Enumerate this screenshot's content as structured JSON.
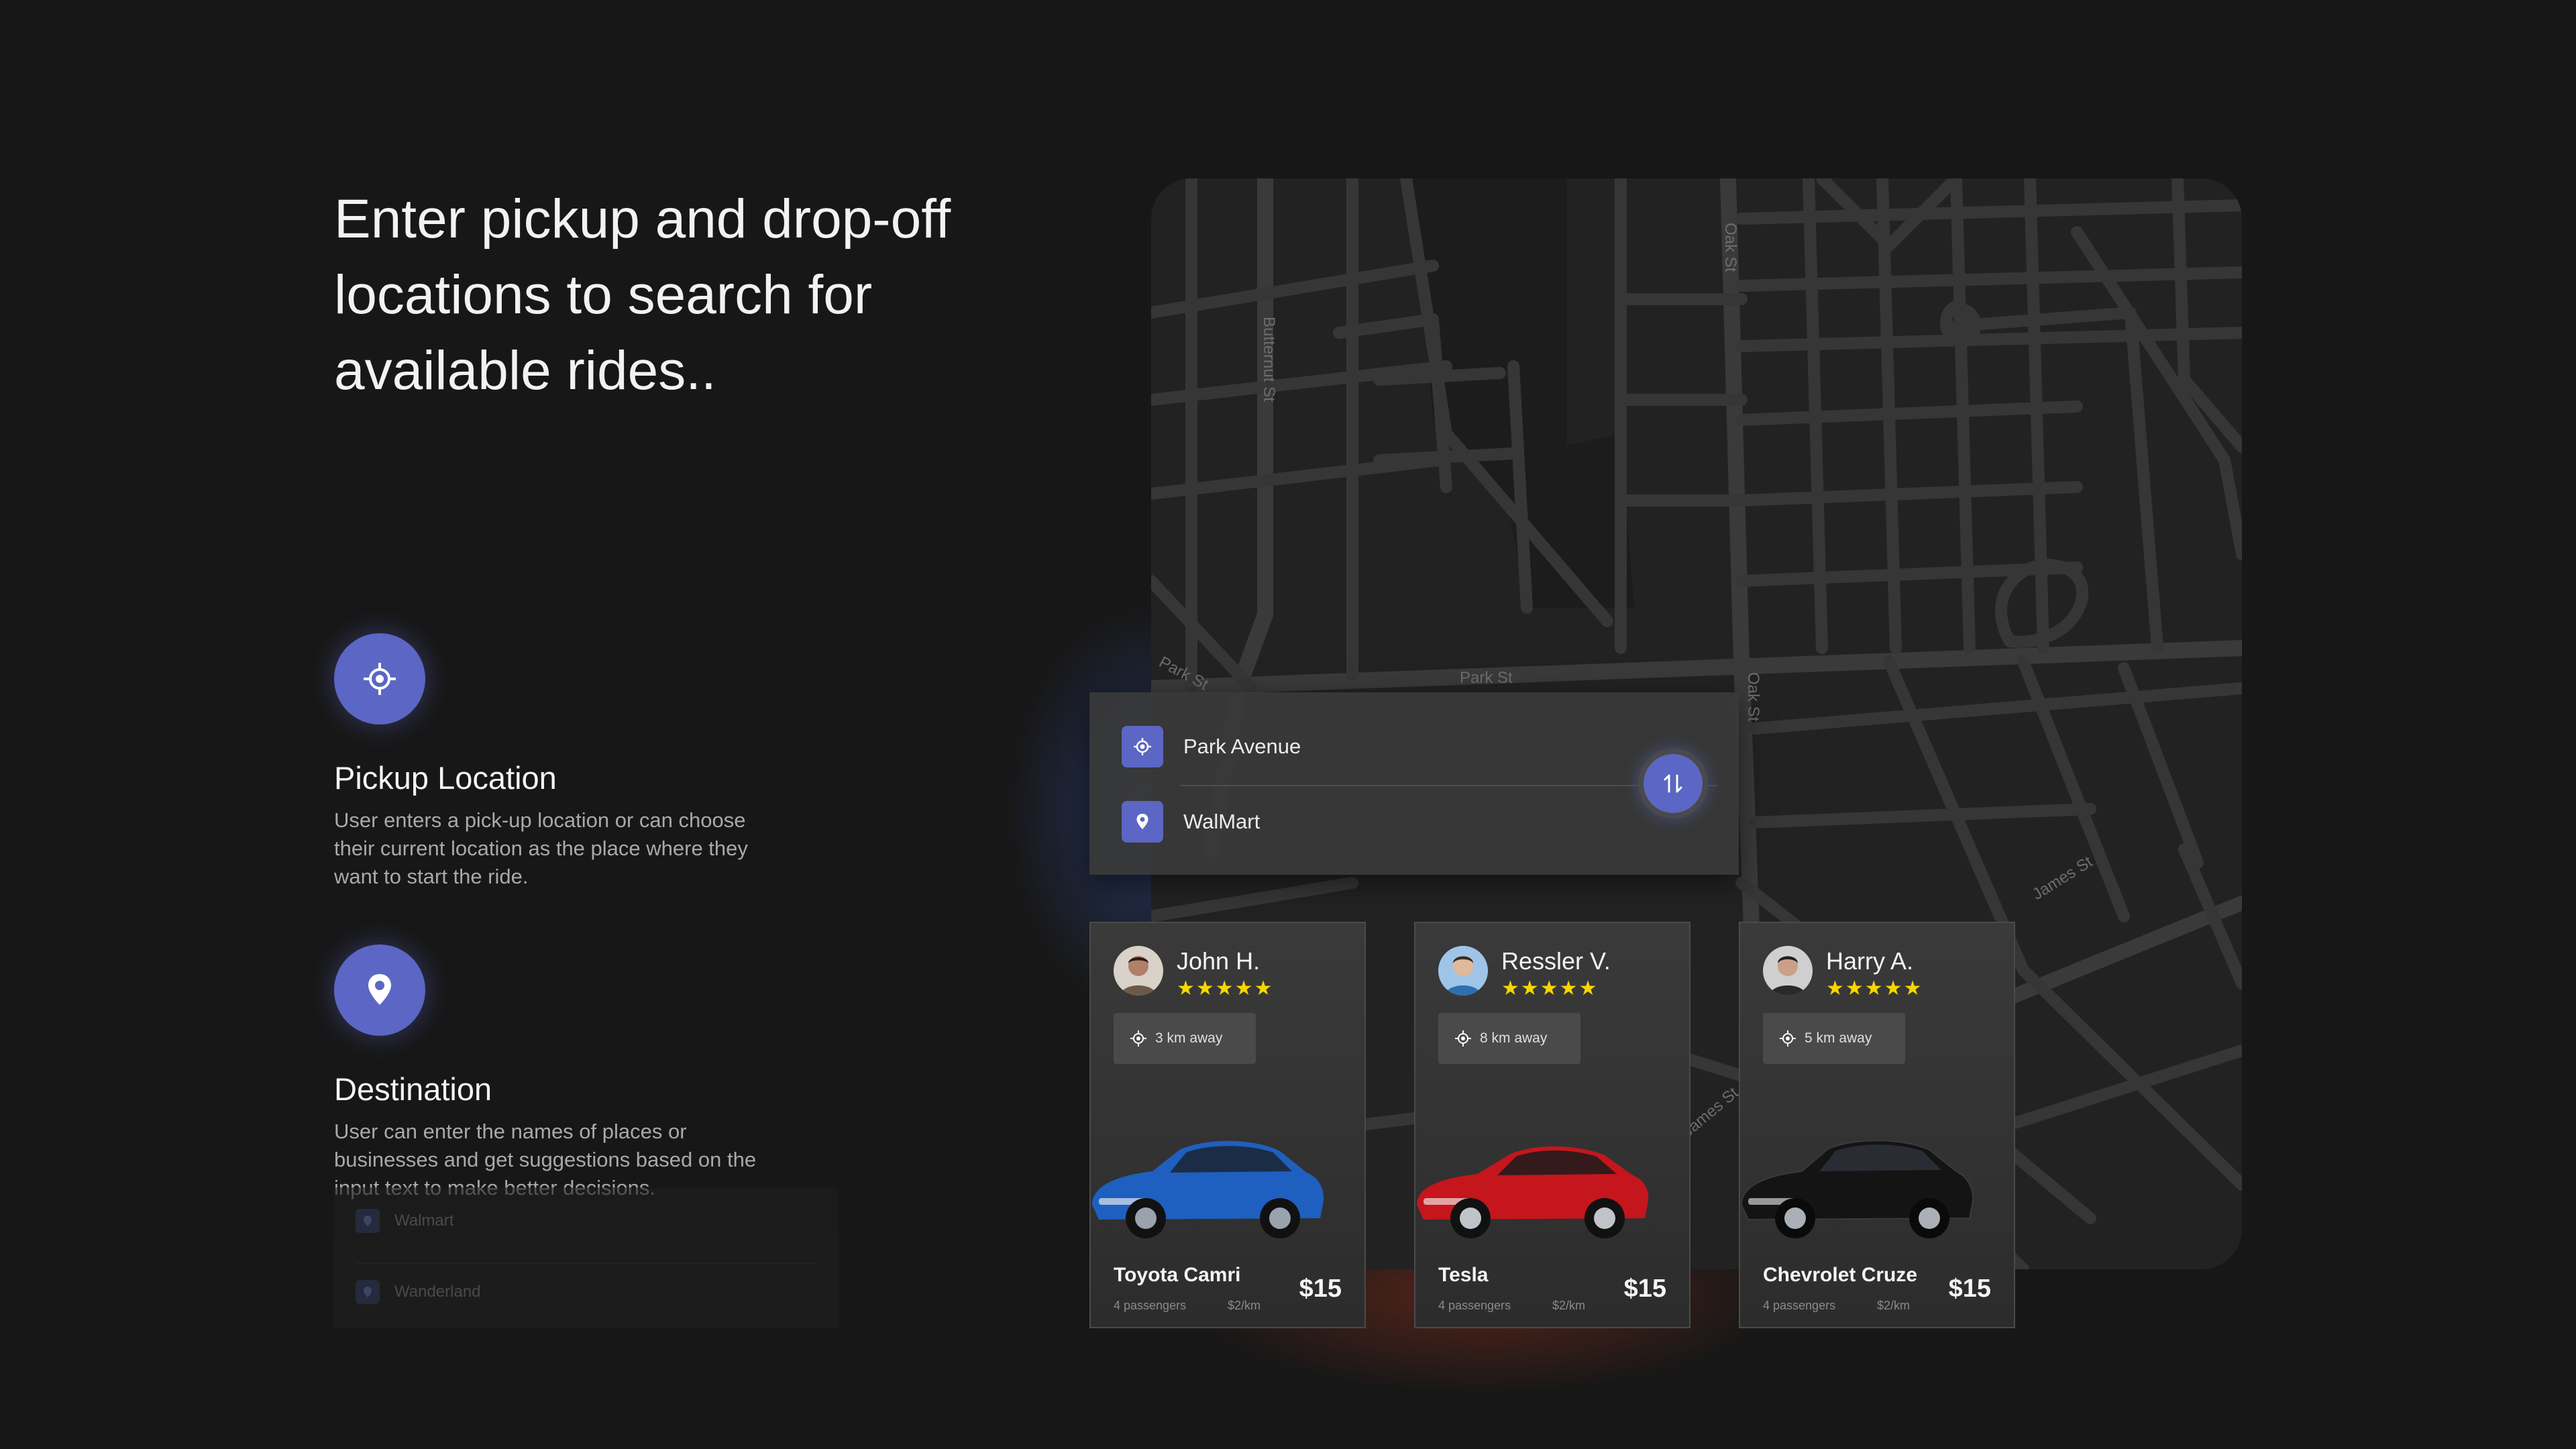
{
  "headline": "Enter pickup and drop-off locations to search for available rides..",
  "features": [
    {
      "icon": "crosshair-icon",
      "title": "Pickup Location",
      "description": "User enters a pick-up location or can choose their current location as the place where they want to start the ride."
    },
    {
      "icon": "map-pin-icon",
      "title": "Destination",
      "description": "User can enter the names of places or businesses and get suggestions based on the input text to make better decisions."
    }
  ],
  "ghost_suggestions": [
    "Walmart",
    "Wanderland"
  ],
  "map": {
    "street_labels": [
      "Butternut St",
      "Oak St",
      "Park St",
      "Park St",
      "Oak St",
      "James St",
      "James St"
    ]
  },
  "search": {
    "pickup": "Park Avenue",
    "destination": "WalMart",
    "swap_icon": "swap-vertical-icon"
  },
  "rides": [
    {
      "driver": "John H.",
      "rating": "★★★★★",
      "distance": "3 km away",
      "car": "Toyota Camri",
      "passengers": "4 passengers",
      "rate": "$2/km",
      "price": "$15",
      "car_color": "#1f5fbf"
    },
    {
      "driver": "Ressler V.",
      "rating": "★★★★★",
      "distance": "8 km away",
      "car": "Tesla",
      "passengers": "4 passengers",
      "rate": "$2/km",
      "price": "$15",
      "car_color": "#c4161c"
    },
    {
      "driver": "Harry A.",
      "rating": "★★★★★",
      "distance": "5 km away",
      "car": "Chevrolet Cruze",
      "passengers": "4 passengers",
      "rate": "$2/km",
      "price": "$15",
      "car_color": "#141414"
    }
  ],
  "colors": {
    "accent": "#5c66c4",
    "background": "#171717",
    "star": "#f5d700"
  }
}
